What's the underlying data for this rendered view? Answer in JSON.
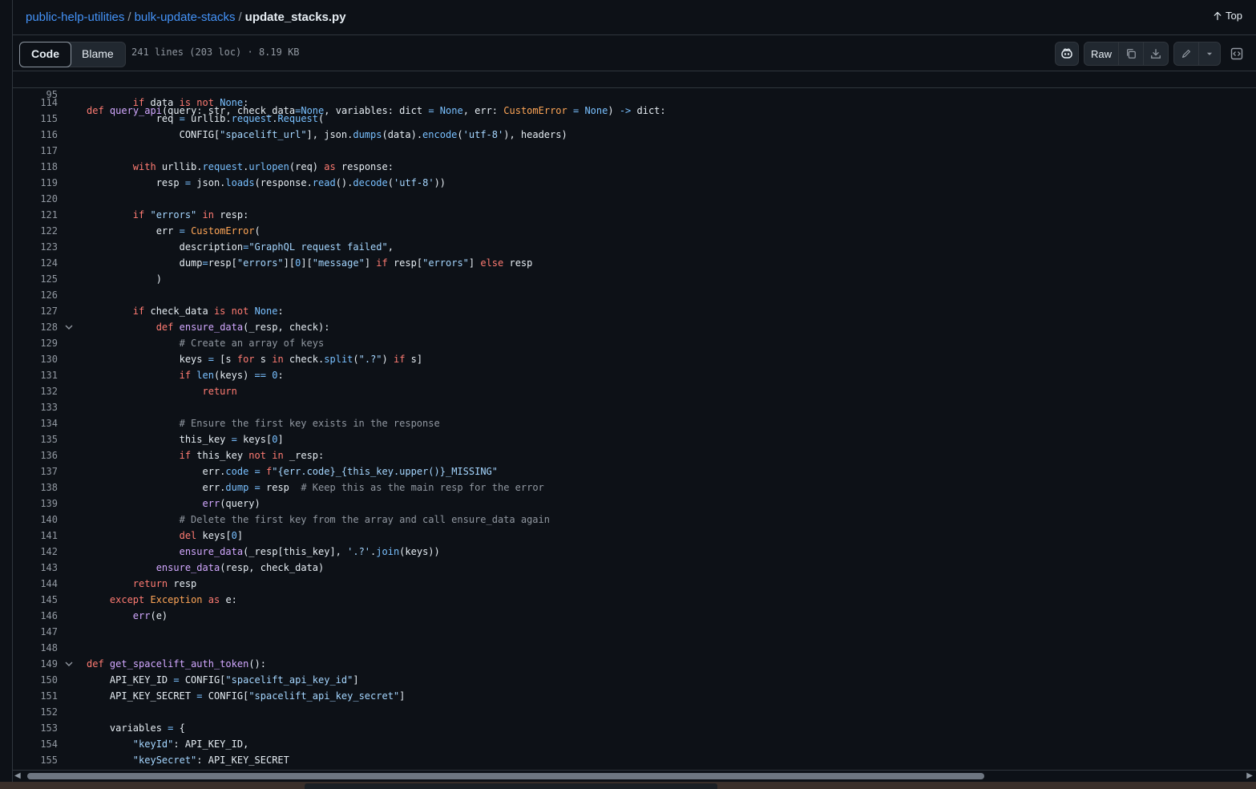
{
  "breadcrumb": {
    "repo": "public-help-utilities",
    "dir": "bulk-update-stacks",
    "file": "update_stacks.py",
    "separator": "/"
  },
  "top_button": {
    "label": "Top",
    "icon": "arrow-up-icon"
  },
  "tabs": [
    {
      "label": "Code",
      "active": true
    },
    {
      "label": "Blame",
      "active": false
    }
  ],
  "file_info": "241 lines (203 loc) · 8.19 KB",
  "actions": {
    "raw_label": "Raw"
  },
  "colors": {
    "background": "#0d1117",
    "link": "#4493f8",
    "keyword": "#ff7b72",
    "function": "#d2a8ff",
    "string": "#a5d6ff",
    "comment": "#9198a1"
  },
  "sticky_line": {
    "number": "95",
    "code": "def query_api(query: str, check_data=None, variables: dict = None, err: CustomError = None) -> dict:"
  },
  "code_lines": [
    {
      "n": "114",
      "code": "        if data is not None:"
    },
    {
      "n": "115",
      "code": "            req = urllib.request.Request("
    },
    {
      "n": "116",
      "code": "                CONFIG[\"spacelift_url\"], json.dumps(data).encode('utf-8'), headers)"
    },
    {
      "n": "117",
      "code": ""
    },
    {
      "n": "118",
      "code": "        with urllib.request.urlopen(req) as response:"
    },
    {
      "n": "119",
      "code": "            resp = json.loads(response.read().decode('utf-8'))"
    },
    {
      "n": "120",
      "code": ""
    },
    {
      "n": "121",
      "code": "        if \"errors\" in resp:"
    },
    {
      "n": "122",
      "code": "            err = CustomError("
    },
    {
      "n": "123",
      "code": "                description=\"GraphQL request failed\","
    },
    {
      "n": "124",
      "code": "                dump=resp[\"errors\"][0][\"message\"] if resp[\"errors\"] else resp"
    },
    {
      "n": "125",
      "code": "            )"
    },
    {
      "n": "126",
      "code": ""
    },
    {
      "n": "127",
      "code": "        if check_data is not None:"
    },
    {
      "n": "128",
      "code": "            def ensure_data(_resp, check):",
      "fold": true
    },
    {
      "n": "129",
      "code": "                # Create an array of keys"
    },
    {
      "n": "130",
      "code": "                keys = [s for s in check.split(\".?\") if s]"
    },
    {
      "n": "131",
      "code": "                if len(keys) == 0:"
    },
    {
      "n": "132",
      "code": "                    return"
    },
    {
      "n": "133",
      "code": ""
    },
    {
      "n": "134",
      "code": "                # Ensure the first key exists in the response"
    },
    {
      "n": "135",
      "code": "                this_key = keys[0]"
    },
    {
      "n": "136",
      "code": "                if this_key not in _resp:"
    },
    {
      "n": "137",
      "code": "                    err.code = f\"{err.code}_{this_key.upper()}_MISSING\""
    },
    {
      "n": "138",
      "code": "                    err.dump = resp  # Keep this as the main resp for the error"
    },
    {
      "n": "139",
      "code": "                    err(query)"
    },
    {
      "n": "140",
      "code": "                # Delete the first key from the array and call ensure_data again"
    },
    {
      "n": "141",
      "code": "                del keys[0]"
    },
    {
      "n": "142",
      "code": "                ensure_data(_resp[this_key], '.?'.join(keys))"
    },
    {
      "n": "143",
      "code": "            ensure_data(resp, check_data)"
    },
    {
      "n": "144",
      "code": "        return resp"
    },
    {
      "n": "145",
      "code": "    except Exception as e:"
    },
    {
      "n": "146",
      "code": "        err(e)"
    },
    {
      "n": "147",
      "code": ""
    },
    {
      "n": "148",
      "code": ""
    },
    {
      "n": "149",
      "code": "def get_spacelift_auth_token():",
      "fold": true
    },
    {
      "n": "150",
      "code": "    API_KEY_ID = CONFIG[\"spacelift_api_key_id\"]"
    },
    {
      "n": "151",
      "code": "    API_KEY_SECRET = CONFIG[\"spacelift_api_key_secret\"]"
    },
    {
      "n": "152",
      "code": ""
    },
    {
      "n": "153",
      "code": "    variables = {"
    },
    {
      "n": "154",
      "code": "        \"keyId\": API_KEY_ID,"
    },
    {
      "n": "155",
      "code": "        \"keySecret\": API_KEY_SECRET"
    }
  ]
}
